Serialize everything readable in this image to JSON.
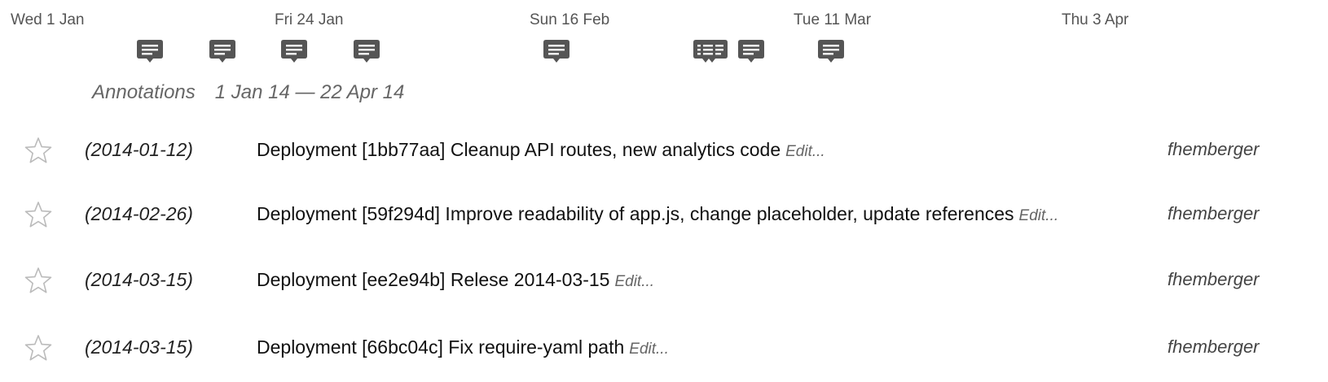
{
  "timeline": {
    "ticks": [
      "Wed 1 Jan",
      "Fri 24 Jan",
      "Sun 16 Feb",
      "Tue 11 Mar",
      "Thu 3 Apr"
    ],
    "markers": [
      "note",
      "note",
      "note",
      "note",
      "note",
      "multi",
      "note",
      "note"
    ]
  },
  "header": {
    "title": "Annotations",
    "range": "1 Jan 14 — 22 Apr 14"
  },
  "annotations": [
    {
      "date": "(2014-01-12)",
      "message": "Deployment [1bb77aa] Cleanup API routes, new analytics code",
      "edit": "Edit...",
      "author": "fhemberger",
      "starred": false
    },
    {
      "date": "(2014-02-26)",
      "message": "Deployment [59f294d] Improve readability of app.js, change placeholder, update references",
      "edit": "Edit...",
      "author": "fhemberger",
      "starred": false
    },
    {
      "date": "(2014-03-15)",
      "message": "Deployment [ee2e94b] Relese 2014-03-15",
      "edit": "Edit...",
      "author": "fhemberger",
      "starred": false
    },
    {
      "date": "(2014-03-15)",
      "message": "Deployment [66bc04c] Fix require-yaml path",
      "edit": "Edit...",
      "author": "fhemberger",
      "starred": false
    }
  ],
  "colors": {
    "marker": "#555555",
    "star_outline": "#bbbbbb",
    "muted_text": "#666666"
  },
  "icons": {
    "marker": "comment-bubble-icon",
    "multi_marker": "multiple-comments-icon",
    "star": "star-outline-icon"
  }
}
